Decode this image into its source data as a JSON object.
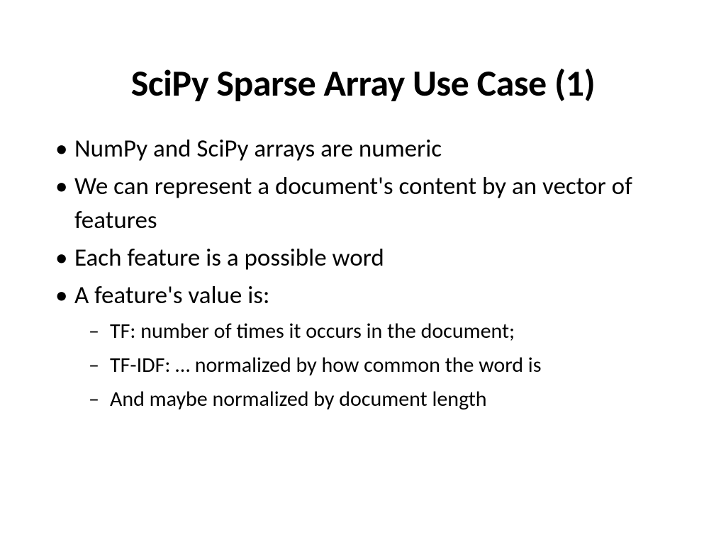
{
  "title": "SciPy Sparse Array Use Case (1)",
  "bullets": [
    "NumPy and SciPy arrays are numeric",
    "We can represent a document's content by an vector of features",
    "Each feature is a possible word",
    "A feature's value is:"
  ],
  "subBullets": [
    " TF: number of times it occurs in the document;",
    "TF-IDF:  … normalized by how common the word is",
    "And maybe normalized by document length"
  ]
}
